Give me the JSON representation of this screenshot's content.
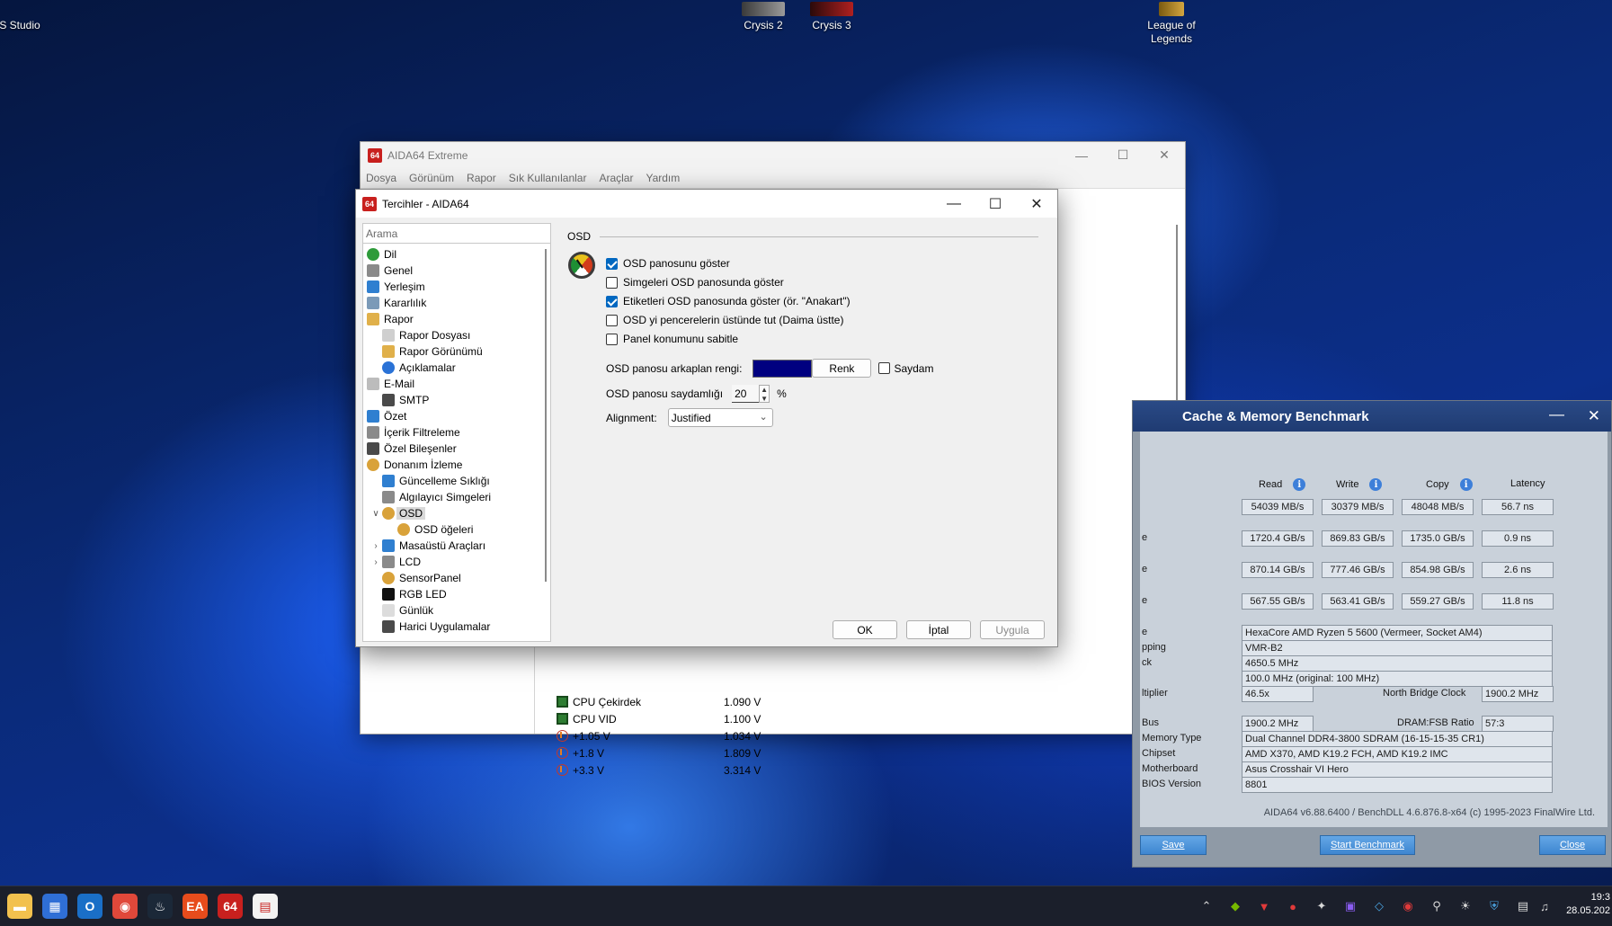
{
  "desktop": {
    "icons": [
      {
        "label": "S Studio"
      },
      {
        "label": "Crysis 2"
      },
      {
        "label": "Crysis 3"
      },
      {
        "label": "League of Legends"
      }
    ]
  },
  "main_window": {
    "title": "AIDA64 Extreme",
    "menu": [
      "Dosya",
      "Görünüm",
      "Rapor",
      "Sık Kullanılanlar",
      "Araçlar",
      "Yardım"
    ],
    "sensors": [
      {
        "name": "CPU Çekirdek",
        "value": "1.090 V",
        "icon": "chip-icon"
      },
      {
        "name": "CPU VID",
        "value": "1.100 V",
        "icon": "chip-icon"
      },
      {
        "name": "+1.05 V",
        "value": "1.034 V",
        "icon": "voltage-icon"
      },
      {
        "name": "+1.8 V",
        "value": "1.809 V",
        "icon": "voltage-icon"
      },
      {
        "name": "+3.3 V",
        "value": "3.314 V",
        "icon": "voltage-icon"
      }
    ]
  },
  "dialog": {
    "title": "Tercihler - AIDA64",
    "search_placeholder": "Arama",
    "tree": [
      {
        "label": "Dil",
        "indent": 0,
        "icon": "globe-icon",
        "color": "#2e9b3a"
      },
      {
        "label": "Genel",
        "indent": 0,
        "icon": "settings-icon",
        "color": "#8a8a8a"
      },
      {
        "label": "Yerleşim",
        "indent": 0,
        "icon": "layout-icon",
        "color": "#2f7fd0"
      },
      {
        "label": "Kararlılık",
        "indent": 0,
        "icon": "stability-icon",
        "color": "#7b9ab8"
      },
      {
        "label": "Rapor",
        "indent": 0,
        "icon": "report-icon",
        "color": "#e0b04a"
      },
      {
        "label": "Rapor Dosyası",
        "indent": 1,
        "icon": "file-icon",
        "color": "#cfcfcf"
      },
      {
        "label": "Rapor Görünümü",
        "indent": 1,
        "icon": "report-view-icon",
        "color": "#e0b04a"
      },
      {
        "label": "Açıklamalar",
        "indent": 1,
        "icon": "info-icon",
        "color": "#2a72d6"
      },
      {
        "label": "E-Mail",
        "indent": 0,
        "icon": "mail-icon",
        "color": "#bcbcbc"
      },
      {
        "label": "SMTP",
        "indent": 1,
        "icon": "server-icon",
        "color": "#4a4a4a"
      },
      {
        "label": "Özet",
        "indent": 0,
        "icon": "summary-icon",
        "color": "#2f7fd0"
      },
      {
        "label": "İçerik Filtreleme",
        "indent": 0,
        "icon": "filter-icon",
        "color": "#8a8a8a"
      },
      {
        "label": "Özel Bileşenler",
        "indent": 0,
        "icon": "component-icon",
        "color": "#4a4a4a"
      },
      {
        "label": "Donanım İzleme",
        "indent": 0,
        "icon": "gauge-icon",
        "color": "#d9a23a"
      },
      {
        "label": "Güncelleme Sıklığı",
        "indent": 1,
        "icon": "refresh-icon",
        "color": "#2f7fd0"
      },
      {
        "label": "Algılayıcı Simgeleri",
        "indent": 1,
        "icon": "sensor-icon",
        "color": "#8a8a8a"
      },
      {
        "label": "OSD",
        "indent": 1,
        "icon": "gauge-icon",
        "color": "#d9a23a",
        "selected": true,
        "expanded": true
      },
      {
        "label": "OSD öğeleri",
        "indent": 2,
        "icon": "gauge-icon",
        "color": "#d9a23a"
      },
      {
        "label": "Masaüstü Araçları",
        "indent": 1,
        "icon": "desktop-tools-icon",
        "color": "#2f7fd0",
        "collapsed": true
      },
      {
        "label": "LCD",
        "indent": 1,
        "icon": "lcd-icon",
        "color": "#8a8a8a",
        "collapsed": true
      },
      {
        "label": "SensorPanel",
        "indent": 1,
        "icon": "gauge-icon",
        "color": "#d9a23a"
      },
      {
        "label": "RGB LED",
        "indent": 1,
        "icon": "rgb-icon",
        "color": "#111111"
      },
      {
        "label": "Günlük",
        "indent": 1,
        "icon": "log-icon",
        "color": "#dcdcdc"
      },
      {
        "label": "Harici Uygulamalar",
        "indent": 1,
        "icon": "external-apps-icon",
        "color": "#4a4a4a"
      }
    ],
    "section_title": "OSD",
    "options": [
      {
        "label": "OSD panosunu göster",
        "checked": true
      },
      {
        "label": "Simgeleri OSD panosunda göster",
        "checked": false
      },
      {
        "label": "Etiketleri OSD panosunda göster (ör. \"Anakart\")",
        "checked": true
      },
      {
        "label": "OSD yi pencerelerin üstünde tut (Daima üstte)",
        "checked": false
      },
      {
        "label": "Panel konumunu sabitle",
        "checked": false
      }
    ],
    "bg_color_label": "OSD panosu arkaplan rengi:",
    "bg_color": "#000080",
    "color_button": "Renk",
    "transparent_label": "Saydam",
    "transparent_checked": false,
    "opacity_label": "OSD panosu saydamlığı",
    "opacity_value": "20",
    "opacity_unit": "%",
    "alignment_label": "Alignment:",
    "alignment_value": "Justified",
    "buttons": {
      "ok": "OK",
      "cancel": "İptal",
      "apply": "Uygula"
    }
  },
  "benchmark": {
    "title": "Cache & Memory Benchmark",
    "columns": [
      "Read",
      "Write",
      "Copy",
      "Latency"
    ],
    "rows": [
      {
        "label": "",
        "values": [
          "54039 MB/s",
          "30379 MB/s",
          "48048 MB/s",
          "56.7 ns"
        ]
      },
      {
        "label": "e",
        "values": [
          "1720.4 GB/s",
          "869.83 GB/s",
          "1735.0 GB/s",
          "0.9 ns"
        ]
      },
      {
        "label": "e",
        "values": [
          "870.14 GB/s",
          "777.46 GB/s",
          "854.98 GB/s",
          "2.6 ns"
        ]
      },
      {
        "label": "e",
        "values": [
          "567.55 GB/s",
          "563.41 GB/s",
          "559.27 GB/s",
          "11.8 ns"
        ]
      }
    ],
    "info": [
      {
        "label": "e",
        "value": "HexaCore AMD Ryzen 5 5600  (Vermeer, Socket AM4)"
      },
      {
        "label": "pping",
        "value": "VMR-B2"
      },
      {
        "label": "ck",
        "value": "4650.5 MHz"
      },
      {
        "label": "",
        "value": "100.0 MHz  (original: 100 MHz)"
      }
    ],
    "multiplier_label": "ltiplier",
    "multiplier_value": "46.5x",
    "nb_clock_label": "North Bridge Clock",
    "nb_clock_value": "1900.2 MHz",
    "bus_label": "Bus",
    "bus_value": "1900.2 MHz",
    "dram_ratio_label": "DRAM:FSB Ratio",
    "dram_ratio_value": "57:3",
    "details": [
      {
        "label": "Memory Type",
        "value": "Dual Channel DDR4-3800 SDRAM  (16-15-15-35 CR1)"
      },
      {
        "label": "Chipset",
        "value": "AMD X370, AMD K19.2 FCH, AMD K19.2 IMC"
      },
      {
        "label": "Motherboard",
        "value": "Asus Crosshair VI Hero"
      },
      {
        "label": "BIOS Version",
        "value": "8801"
      }
    ],
    "footer": "AIDA64 v6.88.6400 / BenchDLL 4.6.876.8-x64  (c) 1995-2023 FinalWire Ltd.",
    "buttons": {
      "save": "Save",
      "start": "Start Benchmark",
      "close": "Close"
    }
  },
  "taskbar": {
    "apps": [
      {
        "name": "file-explorer-icon",
        "color": "#f2c14e",
        "glyph": "▬"
      },
      {
        "name": "store-icon",
        "color": "#2f6fd6",
        "glyph": "▦"
      },
      {
        "name": "outlook-icon",
        "color": "#1a6fc7",
        "glyph": "O"
      },
      {
        "name": "chrome-icon",
        "color": "#e0483a",
        "glyph": "◉"
      },
      {
        "name": "steam-icon",
        "color": "#1b2838",
        "glyph": "♨"
      },
      {
        "name": "ea-icon",
        "color": "#e74c1c",
        "glyph": "EA"
      },
      {
        "name": "aida64-icon",
        "color": "#c8201e",
        "glyph": "64"
      },
      {
        "name": "paint-icon",
        "color": "#f3f3f3",
        "glyph": "▤"
      }
    ],
    "time": "19:3",
    "date": "28.05.202"
  }
}
